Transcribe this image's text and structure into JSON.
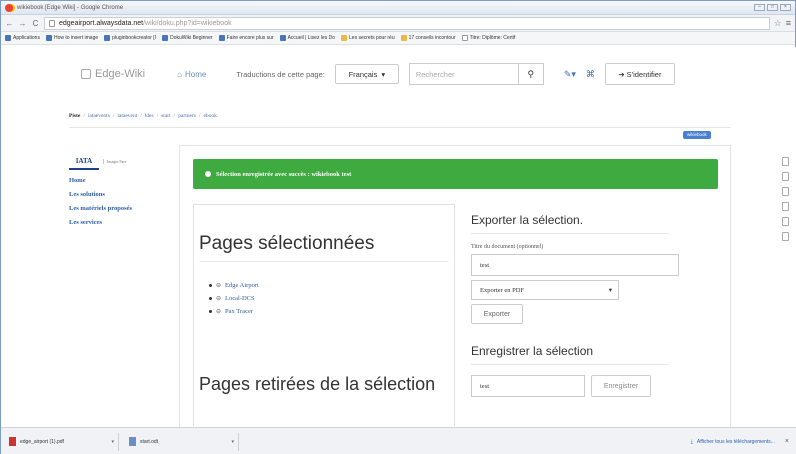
{
  "window": {
    "title": "wikiebook [Edge Wiki] - Google Chrome",
    "controls": [
      "–",
      "□",
      "×"
    ]
  },
  "addressbar": {
    "back": "←",
    "forward": "→",
    "reload": "C",
    "url_domain": "edgeairport.alwaysdata.net",
    "url_path": "/wiki/doku.php?id=wikiebook",
    "star": "☆",
    "menu": "≡"
  },
  "bookmarks": [
    {
      "label": "Applications"
    },
    {
      "label": "How to insert image"
    },
    {
      "label": "pluginbookcreator [I"
    },
    {
      "label": "DokuWiki Beginner"
    },
    {
      "label": "Faire encore plus sur"
    },
    {
      "label": "Accueil | Lisez les Do"
    },
    {
      "label": "Les secrets pour réu"
    },
    {
      "label": "17 conseils incontour"
    },
    {
      "label": "Titre: Diplôme: Certif"
    }
  ],
  "topnav": {
    "logo": "Edge-Wiki",
    "home": "Home",
    "translations_label": "Traductions de cette page:",
    "language": "Français",
    "search_placeholder": "Rechercher",
    "login": "S'identifier"
  },
  "breadcrumb": {
    "label": "Piste",
    "items": [
      "iataevents",
      "iataevent",
      "ldes",
      "start",
      "partners",
      "ebook"
    ]
  },
  "pagename_badge": "wikiebook",
  "sidebar": {
    "logo_text": "IATA",
    "logo_tag": "Imagin Fare",
    "items": [
      "Home",
      "Les solutions",
      "Les matériels proposés",
      "Les services"
    ]
  },
  "alert": {
    "message": "Sélection enregistrée avec succès : wikiebook test",
    "color": "#3eaa3f"
  },
  "selected": {
    "title": "Pages sélectionnées",
    "items": [
      "Edge Airport",
      "Local-DCS",
      "Pax Tracer"
    ]
  },
  "removed": {
    "title": "Pages retirées de la sélection"
  },
  "export": {
    "title": "Exporter la sélection.",
    "doc_title_label": "Titre du document (optionnel)",
    "doc_title_value": "test",
    "format": "Exporter en PDF",
    "button": "Exporter"
  },
  "save": {
    "title": "Enregistrer la sélection",
    "value": "test",
    "button": "Enregistrer"
  },
  "downloads": {
    "items": [
      "edge_airport (1).pdf",
      "start.odt"
    ],
    "show_all": "Afficher tous les téléchargements...",
    "close": "×"
  }
}
